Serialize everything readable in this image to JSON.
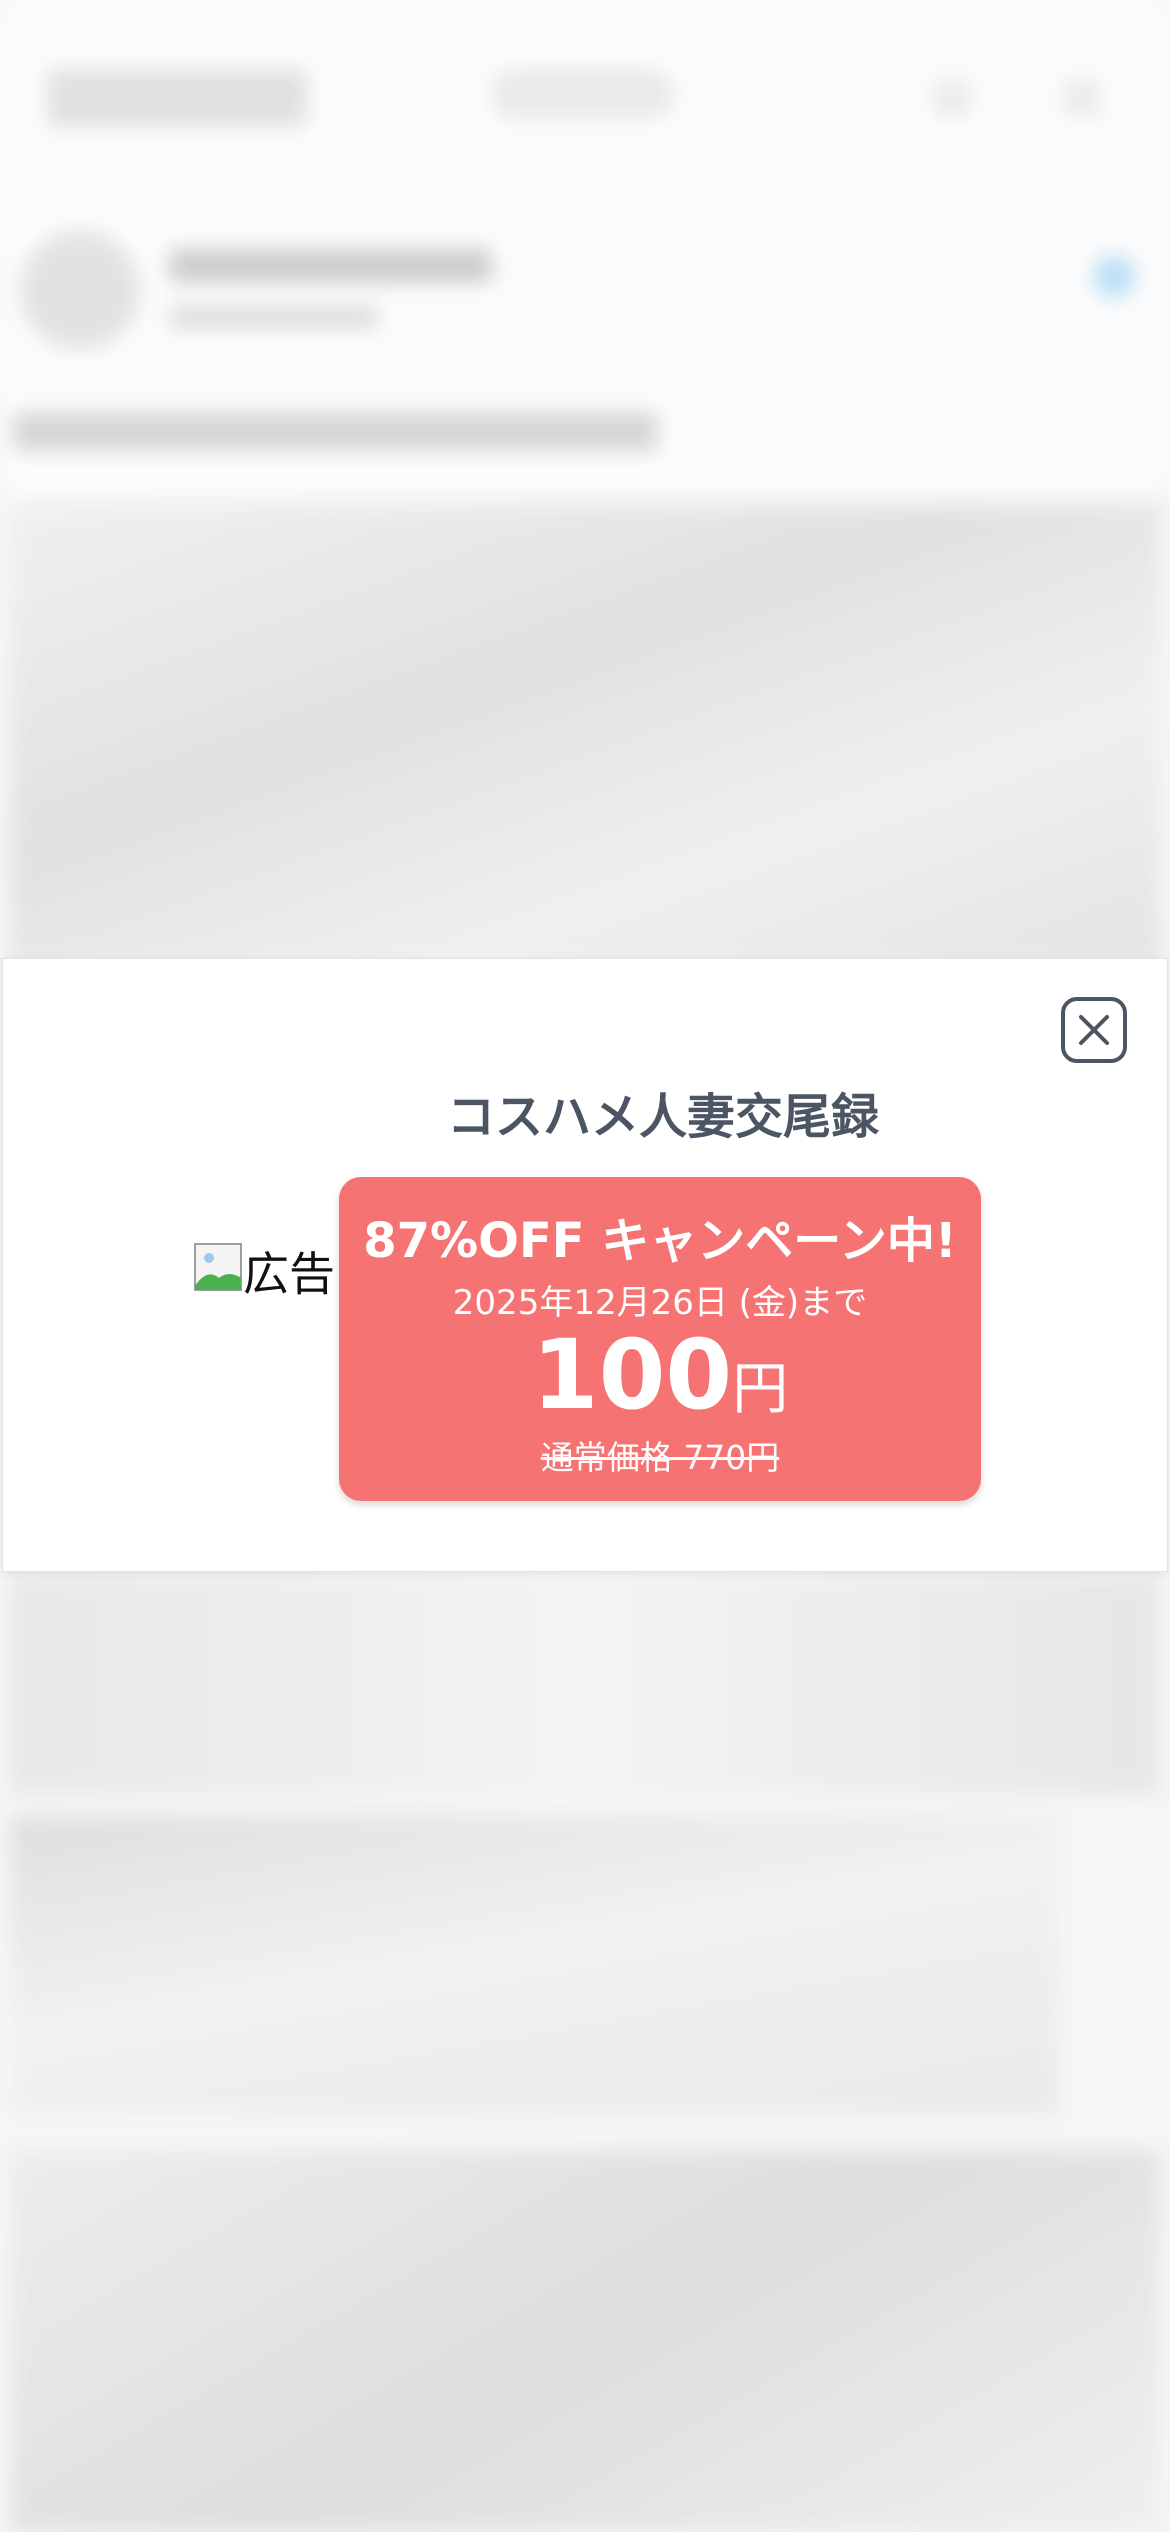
{
  "popup": {
    "title": "コスハメ人妻交尾録",
    "ad_image_alt": "広告",
    "campaign": {
      "headline": "87%OFF キャンペーン中!",
      "deadline": "2025年12月26日 (金)まで",
      "price": "100",
      "price_unit": "円",
      "regular_price": "通常価格 770円"
    },
    "colors": {
      "campaign_bg": "#f57373",
      "title_text": "#4b5563",
      "close_border": "#4b5563"
    },
    "icons": {
      "close": "close-icon",
      "broken_image": "broken-image-icon"
    }
  }
}
